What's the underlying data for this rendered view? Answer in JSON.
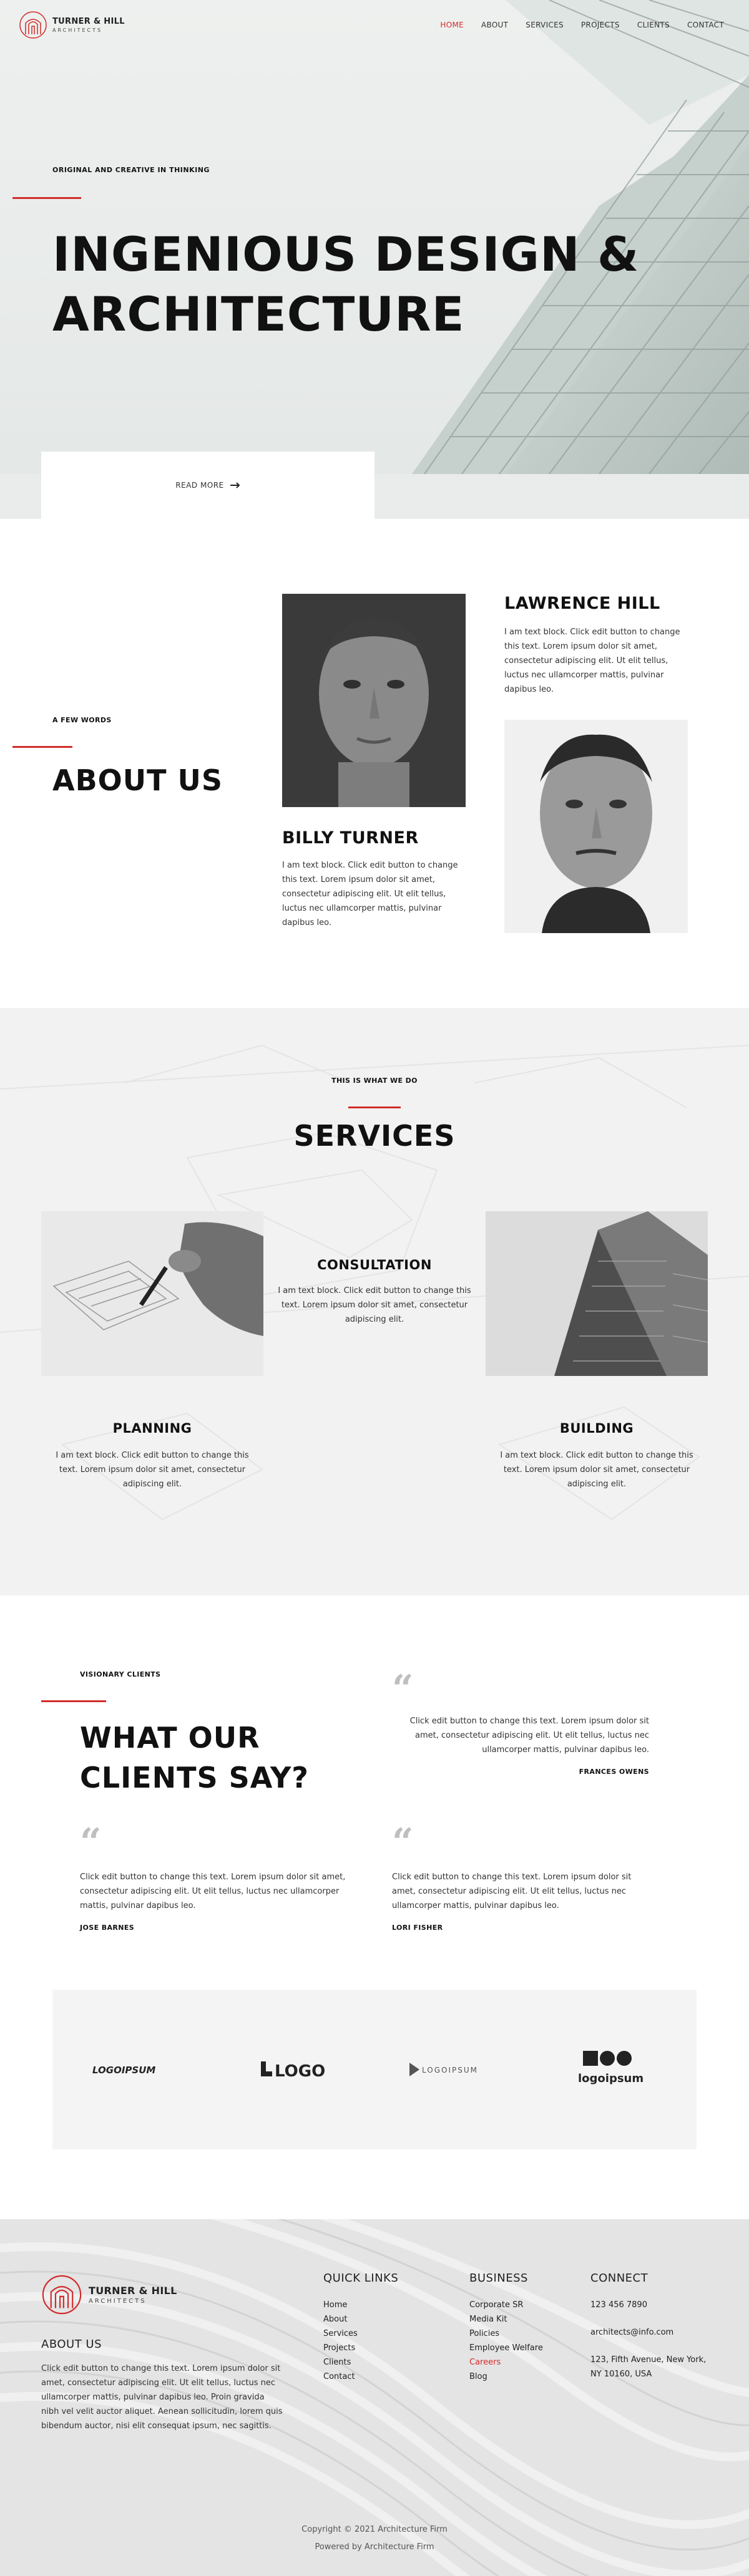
{
  "header": {
    "logo_line1": "TURNER & HILL",
    "logo_line2": "ARCHITECTS",
    "nav": [
      "HOME",
      "ABOUT",
      "SERVICES",
      "PROJECTS",
      "CLIENTS",
      "CONTACT"
    ],
    "active_nav": "HOME",
    "accent_color": "#d22b2b"
  },
  "hero": {
    "kicker": "ORIGINAL AND CREATIVE IN THINKING",
    "title_line1": "INGENIOUS DESIGN &",
    "title_line2": "ARCHITECTURE",
    "read_more": "READ MORE",
    "arrow_icon": "arrow-right-icon"
  },
  "about": {
    "kicker": "A FEW WORDS",
    "title": "ABOUT US",
    "people": [
      {
        "name": "BILLY TURNER",
        "text": "I am text block. Click edit button to change this text. Lorem ipsum dolor sit amet, consectetur adipiscing elit. Ut elit tellus, luctus nec ullamcorper mattis, pulvinar dapibus leo."
      },
      {
        "name": "LAWRENCE HILL",
        "text": "I am text block. Click edit button to change this text. Lorem ipsum dolor sit amet, consectetur adipiscing elit. Ut elit tellus, luctus nec ullamcorper mattis, pulvinar dapibus leo."
      }
    ]
  },
  "services": {
    "kicker": "THIS IS WHAT WE DO",
    "title": "SERVICES",
    "items": [
      {
        "name": "CONSULTATION",
        "text": "I am text block. Click edit button to change this text. Lorem ipsum dolor sit amet, consectetur adipiscing elit."
      },
      {
        "name": "PLANNING",
        "text": "I am text block. Click edit button to change this text. Lorem ipsum dolor sit amet, consectetur adipiscing elit."
      },
      {
        "name": "BUILDING",
        "text": "I am text block. Click edit button to change this text. Lorem ipsum dolor sit amet, consectetur adipiscing elit."
      }
    ]
  },
  "testimonials": {
    "kicker": "VISIONARY CLIENTS",
    "title_line1": "WHAT OUR",
    "title_line2": "CLIENTS SAY?",
    "quotes": [
      {
        "text": "Click edit button to change this text. Lorem ipsum dolor sit amet, consectetur adipiscing elit. Ut elit tellus, luctus nec ullamcorper mattis, pulvinar dapibus leo.",
        "author": "FRANCES OWENS"
      },
      {
        "text": "Click edit button to change this text. Lorem ipsum dolor sit amet, consectetur adipiscing elit. Ut elit tellus, luctus nec ullamcorper mattis, pulvinar dapibus leo.",
        "author": "JOSE BARNES"
      },
      {
        "text": "Click edit button to change this text. Lorem ipsum dolor sit amet, consectetur adipiscing elit. Ut elit tellus, luctus nec ullamcorper mattis, pulvinar dapibus leo.",
        "author": "LORI FISHER"
      }
    ]
  },
  "client_logos": [
    {
      "text": "LOGOIPSUM",
      "icon": "logoipsum-wordmark-icon"
    },
    {
      "text": "LOGO",
      "icon": "logo-wordmark-icon"
    },
    {
      "text": "LOGOIPSUM",
      "icon": "logoipsum-triangle-icon"
    },
    {
      "text": "logoipsum",
      "icon": "logoipsum-shapes-icon"
    }
  ],
  "footer": {
    "logo_line1": "TURNER & HILL",
    "logo_line2": "ARCHITECTS",
    "about_title": "ABOUT US",
    "about_text": "Click edit button to change this text. Lorem ipsum dolor sit amet, consectetur adipiscing elit. Ut elit tellus, luctus nec ullamcorper mattis, pulvinar dapibus leo. Proin gravida nibh vel velit auctor aliquet. Aenean sollicitudin, lorem quis bibendum auctor, nisi elit consequat ipsum, nec sagittis.",
    "quick_links_title": "QUICK LINKS",
    "quick_links": [
      "Home",
      "About",
      "Services",
      "Projects",
      "Clients",
      "Contact"
    ],
    "business_title": "BUSINESS",
    "business_links": [
      "Corporate SR",
      "Media Kit",
      "Policies",
      "Employee Welfare",
      "Careers",
      "Blog"
    ],
    "business_highlight": "Careers",
    "connect_title": "CONNECT",
    "phone": "123 456 7890",
    "email": "architects@info.com",
    "address_line1": "123, Fifth Avenue, New York,",
    "address_line2": "NY 10160, USA",
    "copyright": "Copyright © 2021 Architecture Firm",
    "powered": "Powered by Architecture Firm"
  }
}
